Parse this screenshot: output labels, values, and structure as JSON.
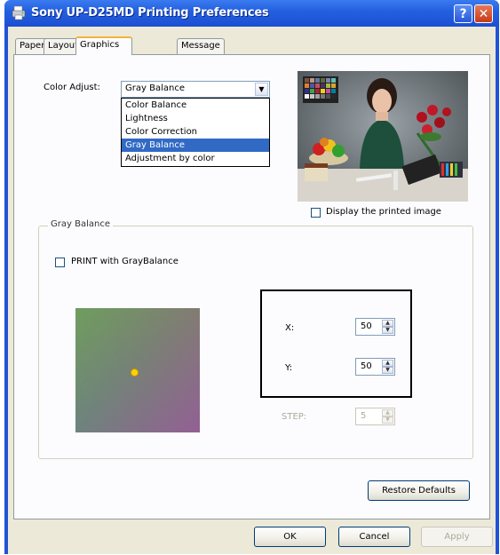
{
  "window": {
    "title": "Sony UP-D25MD Printing Preferences",
    "help_glyph": "?",
    "close_glyph": "✕"
  },
  "tabs": [
    {
      "label": "Paper",
      "active": false
    },
    {
      "label": "Layout",
      "active": false
    },
    {
      "label": "Graphics",
      "active": true
    },
    {
      "label": "Message",
      "active": false
    }
  ],
  "color_adjust": {
    "label": "Color Adjust:",
    "selected": "Gray Balance",
    "options": [
      "Color Balance",
      "Lightness",
      "Color Correction",
      "Gray Balance",
      "Adjustment by color"
    ],
    "highlighted_index": 3
  },
  "preview": {
    "display_printed_label": "Display the printed image",
    "checked": false
  },
  "gray_balance": {
    "group_title": "Gray Balance",
    "print_label": "PRINT with GrayBalance",
    "print_checked": false,
    "x_label": "X:",
    "x_value": "50",
    "y_label": "Y:",
    "y_value": "50",
    "step_label": "STEP:",
    "step_value": "5"
  },
  "buttons": {
    "restore_defaults": "Restore Defaults",
    "ok": "OK",
    "cancel": "Cancel",
    "apply": "Apply"
  },
  "colors": {
    "titlebar": "#2460e0",
    "selection": "#316ac5",
    "dialog_bg": "#ece9d8",
    "pad_marker": "#ffd200"
  }
}
